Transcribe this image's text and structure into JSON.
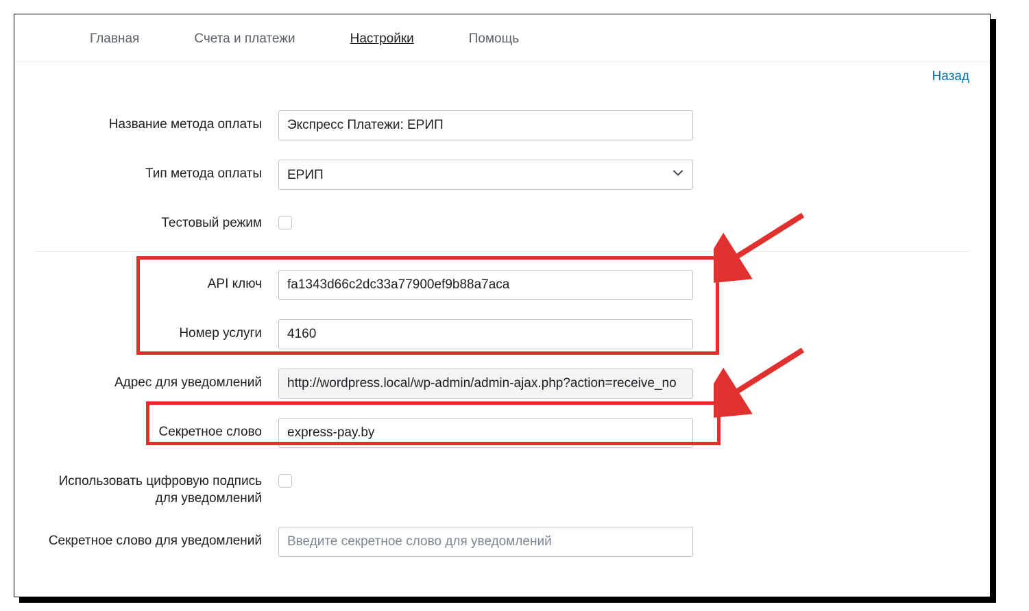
{
  "nav": {
    "main": "Главная",
    "accounts": "Счета и платежи",
    "settings": "Настройки",
    "help": "Помощь"
  },
  "back_link": "Назад",
  "form": {
    "method_name_label": "Название метода оплаты",
    "method_name_value": "Экспресс Платежи: ЕРИП",
    "method_type_label": "Тип метода оплаты",
    "method_type_value": "ЕРИП",
    "test_mode_label": "Тестовый режим",
    "api_key_label": "API ключ",
    "api_key_value": "fa1343d66c2dc33a77900ef9b88a7aca",
    "service_number_label": "Номер услуги",
    "service_number_value": "4160",
    "notify_url_label": "Адрес для уведомлений",
    "notify_url_value": "http://wordpress.local/wp-admin/admin-ajax.php?action=receive_no",
    "secret_word_label": "Секретное слово",
    "secret_word_value": "express-pay.by",
    "use_signature_label": "Использовать цифровую подпись для уведомлений",
    "secret_notify_label": "Секретное слово для уведомлений",
    "secret_notify_placeholder": "Введите секретное слово для уведомлений"
  },
  "annotations": {
    "highlight_color": "#e0312f"
  }
}
